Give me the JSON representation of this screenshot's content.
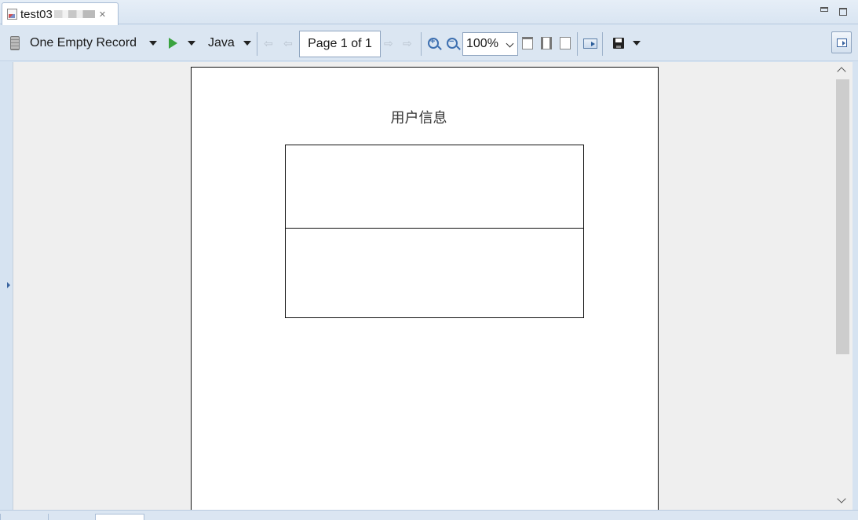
{
  "window": {
    "tab_title": "test03",
    "controls": [
      "minimize-icon",
      "maximize-icon"
    ]
  },
  "toolbar": {
    "data_source_label": "One Empty Record",
    "language_label": "Java",
    "page_indicator": "Page 1 of 1",
    "zoom_value": "100%",
    "icons": [
      "database-icon",
      "run-icon",
      "first-page-icon",
      "previous-page-icon",
      "next-page-icon",
      "last-page-icon",
      "zoom-in-icon",
      "zoom-out-icon",
      "actual-size-icon",
      "fit-page-icon",
      "fit-width-icon",
      "export-icon",
      "save-icon"
    ]
  },
  "report": {
    "title": "用户信息"
  },
  "colors": {
    "toolbar_bg": "#dbe6f2",
    "preview_bg": "#efefef",
    "paper_bg": "#ffffff",
    "run_green": "#3aa33f",
    "accent_blue": "#3d6fb0"
  }
}
